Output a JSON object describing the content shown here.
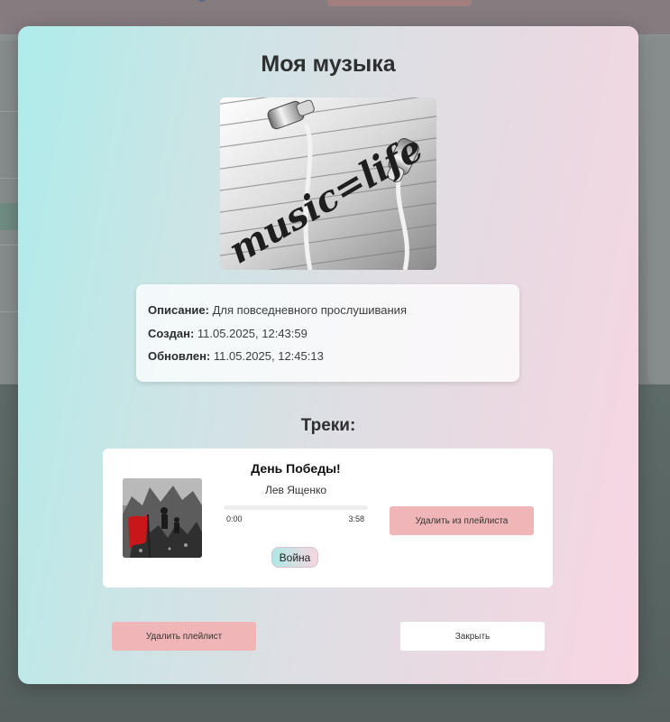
{
  "modal": {
    "title": "Моя музыка",
    "cover_image": "earphones-music-life-cover",
    "cover_text": "music=life",
    "info": {
      "description_label": "Описание:",
      "description_value": "Для повседневного прослушивания",
      "created_label": "Создан:",
      "created_value": "11.05.2025, 12:43:59",
      "updated_label": "Обновлен:",
      "updated_value": "11.05.2025, 12:45:13"
    },
    "tracks_title": "Треки:",
    "tracks": [
      {
        "title": "День Победы!",
        "artist": "Лев Ященко",
        "time_current": "0:00",
        "time_total": "3:58",
        "progress": 0,
        "genre": "Война",
        "cover_image": "victory-banner-cover",
        "remove_label": "Удалить из плейлиста"
      }
    ],
    "delete_playlist_label": "Удалить плейлист",
    "close_label": "Закрыть"
  },
  "colors": {
    "danger_button": "#f0b6b7",
    "modal_gradient_start": "#aeeceb",
    "modal_gradient_end": "#f8d6e2"
  }
}
